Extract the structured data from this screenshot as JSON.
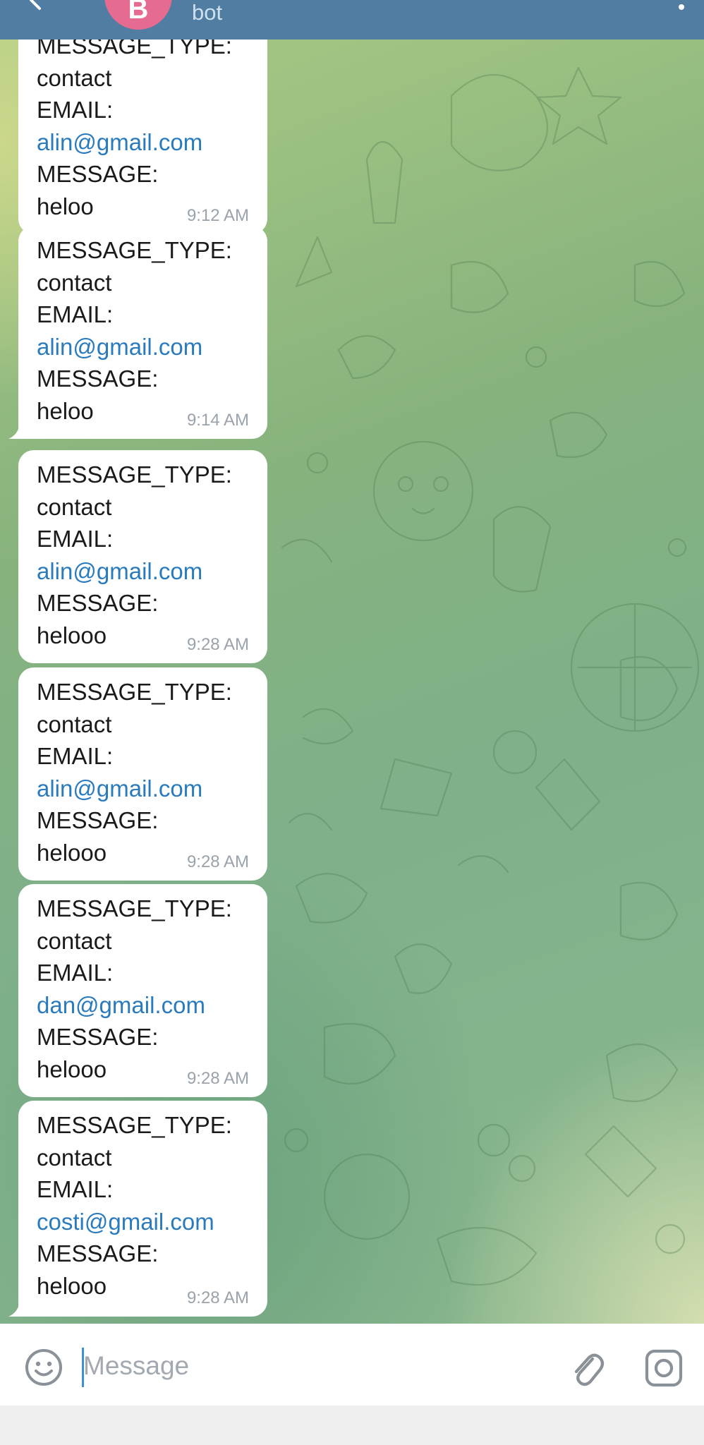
{
  "header": {
    "avatar_initial": "B",
    "subtitle": "bot"
  },
  "messages": [
    {
      "type_label": "MESSAGE_TYPE:",
      "type_value": "contact",
      "email_label": "EMAIL:",
      "email": "alin@gmail.com",
      "message_label": "MESSAGE:",
      "message": "heloo",
      "time": "9:12 AM"
    },
    {
      "type_label": "MESSAGE_TYPE:",
      "type_value": "contact",
      "email_label": "EMAIL:",
      "email": "alin@gmail.com",
      "message_label": "MESSAGE:",
      "message": "heloo",
      "time": "9:14 AM"
    },
    {
      "type_label": "MESSAGE_TYPE:",
      "type_value": "contact",
      "email_label": "EMAIL:",
      "email": "alin@gmail.com",
      "message_label": "MESSAGE:",
      "message": "helooo",
      "time": "9:28 AM"
    },
    {
      "type_label": "MESSAGE_TYPE:",
      "type_value": "contact",
      "email_label": "EMAIL:",
      "email": "alin@gmail.com",
      "message_label": "MESSAGE:",
      "message": "helooo",
      "time": "9:28 AM"
    },
    {
      "type_label": "MESSAGE_TYPE:",
      "type_value": "contact",
      "email_label": "EMAIL:",
      "email": "dan@gmail.com",
      "message_label": "MESSAGE:",
      "message": "helooo",
      "time": "9:28 AM"
    },
    {
      "type_label": "MESSAGE_TYPE:",
      "type_value": "contact",
      "email_label": "EMAIL:",
      "email": "costi@gmail.com",
      "message_label": "MESSAGE:",
      "message": "helooo",
      "time": "9:28 AM"
    }
  ],
  "composer": {
    "placeholder": "Message",
    "value": ""
  },
  "colors": {
    "header_bg": "#517da2",
    "avatar_bg": "#e56b90",
    "link": "#2a7bbd",
    "bubble_bg": "#ffffff",
    "timestamp": "#9aa3ab"
  },
  "icons": {
    "back": "back-arrow-icon",
    "menu": "more-vertical-icon",
    "emoji": "emoji-icon",
    "attach": "paperclip-icon",
    "camera": "camera-icon"
  }
}
